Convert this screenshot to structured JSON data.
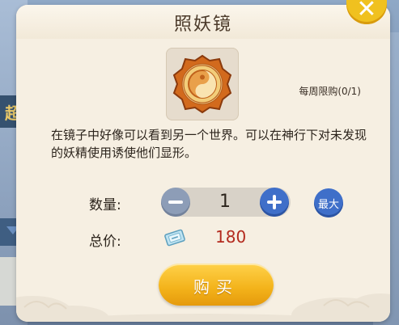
{
  "dialog": {
    "title": "照妖镜",
    "close_label": "✕",
    "item_name": "照妖镜",
    "weekly_limit": "每周限购(0/1)",
    "description": "在镜子中好像可以看到另一个世界。可以在神行下对未发现的妖精使用诱使他们显形。"
  },
  "purchase": {
    "quantity_label": "数量:",
    "quantity_value": "1",
    "max_label": "最大",
    "price_label": "总价:",
    "price_value": "180",
    "buy_label": "购买"
  },
  "background": {
    "left_badge_char": "超"
  },
  "icons": {
    "item": "ornate-mirror-icon",
    "currency": "ticket-icon",
    "close": "close-icon",
    "minus": "minus-icon",
    "plus": "plus-icon"
  },
  "colors": {
    "accent_blue": "#3f6fc9",
    "button_gold": "#f3b21a",
    "price_red": "#b32a1e",
    "panel_bg": "#f6efe2"
  }
}
